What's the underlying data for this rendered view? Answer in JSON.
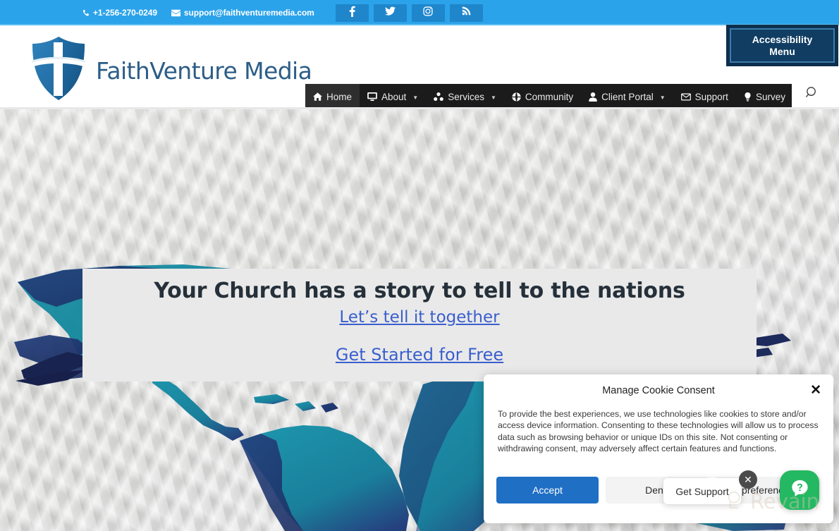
{
  "topbar": {
    "phone": "+1-256-270-0249",
    "email": "support@faithventuremedia.com",
    "phone_icon": "phone-icon",
    "email_icon": "envelope-icon",
    "bg_color": "#2ba3ea",
    "social": [
      {
        "name": "facebook",
        "label": "f"
      },
      {
        "name": "twitter",
        "label": ""
      },
      {
        "name": "instagram",
        "label": ""
      },
      {
        "name": "rss",
        "label": ""
      }
    ]
  },
  "header": {
    "logo_text": "FaithVenture Media",
    "logo_icon": "shield-cross-logo",
    "accessibility": {
      "line1": "Accessibility",
      "line2": "Menu",
      "bg_color": "#113d63"
    },
    "search_icon": "search-icon"
  },
  "nav": {
    "bg_color": "#1b1b1b",
    "items": [
      {
        "label": "Home",
        "icon": "home-icon",
        "caret": false,
        "active": true
      },
      {
        "label": "About",
        "icon": "monitor-icon",
        "caret": true,
        "active": false
      },
      {
        "label": "Services",
        "icon": "sitemap-icon",
        "caret": true,
        "active": false
      },
      {
        "label": "Community",
        "icon": "globe-icon",
        "caret": false,
        "active": false
      },
      {
        "label": "Client Portal",
        "icon": "user-icon",
        "caret": true,
        "active": false
      },
      {
        "label": "Support",
        "icon": "envelope-icon",
        "caret": false,
        "active": false
      },
      {
        "label": "Survey",
        "icon": "lightbulb-icon",
        "caret": false,
        "active": false
      }
    ]
  },
  "hero": {
    "title": "Your Church has a story to tell to the nations",
    "link1": "Let’s tell it together",
    "link2": "Get Started for Free",
    "link_color": "#3a5fcd",
    "card_bg": "#e9e9e9",
    "background_image": "crumpled-paper-world-map"
  },
  "cookie_dialog": {
    "title": "Manage Cookie Consent",
    "close_icon": "close-icon",
    "body": "To provide the best experiences, we use technologies like cookies to store and/or access device information. Consenting to these technologies will allow us to process data such as browsing behavior or unique IDs on this site. Not consenting or withdrawing consent, may adversely affect certain features and functions.",
    "accept_label": "Accept",
    "deny_label": "Deny",
    "preferences_label": "preferences",
    "accept_color": "#1f6fc4"
  },
  "support_widget": {
    "tooltip_label": "Get Support",
    "tooltip_close_icon": "close-circle-icon",
    "bubble_icon": "chat-question-icon",
    "bubble_color": "#25b862"
  },
  "watermark": {
    "text": "Revain",
    "icon": "revain-logo-icon"
  }
}
